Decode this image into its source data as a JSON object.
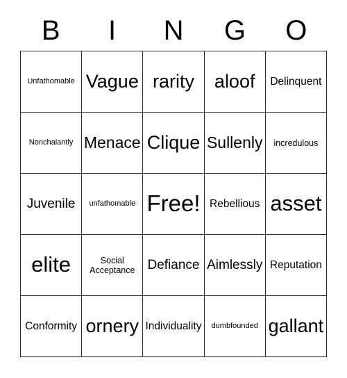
{
  "card": {
    "header": {
      "letters": [
        "B",
        "I",
        "N",
        "G",
        "O"
      ]
    },
    "rows": [
      [
        {
          "text": "Unfathomable",
          "size": "s-xs"
        },
        {
          "text": "Vague",
          "size": "s-xxl"
        },
        {
          "text": "rarity",
          "size": "s-xxl"
        },
        {
          "text": "aloof",
          "size": "s-xxl"
        },
        {
          "text": "Delinquent",
          "size": "s-md"
        }
      ],
      [
        {
          "text": "Nonchalantly",
          "size": "s-xs"
        },
        {
          "text": "Menace",
          "size": "s-xl"
        },
        {
          "text": "Clique",
          "size": "s-xxl"
        },
        {
          "text": "Sullenly",
          "size": "s-xl"
        },
        {
          "text": "incredulous",
          "size": "s-sm"
        }
      ],
      [
        {
          "text": "Juvenile",
          "size": "s-lg"
        },
        {
          "text": "unfathomable",
          "size": "s-xs"
        },
        {
          "text": "Free!",
          "size": "s-free"
        },
        {
          "text": "Rebellious",
          "size": "s-md"
        },
        {
          "text": "asset",
          "size": "s-huge"
        }
      ],
      [
        {
          "text": "elite",
          "size": "s-huge"
        },
        {
          "text": "Social Acceptance",
          "size": "s-sm"
        },
        {
          "text": "Defiance",
          "size": "s-lg"
        },
        {
          "text": "Aimlessly",
          "size": "s-lg"
        },
        {
          "text": "Reputation",
          "size": "s-md"
        }
      ],
      [
        {
          "text": "Conformity",
          "size": "s-md"
        },
        {
          "text": "ornery",
          "size": "s-xxl"
        },
        {
          "text": "Individuality",
          "size": "s-md"
        },
        {
          "text": "dumbfounded",
          "size": "s-xs"
        },
        {
          "text": "gallant",
          "size": "s-xxl"
        }
      ]
    ],
    "colors": {
      "border": "#2b2b2b",
      "text": "#000000",
      "background": "#ffffff"
    }
  }
}
